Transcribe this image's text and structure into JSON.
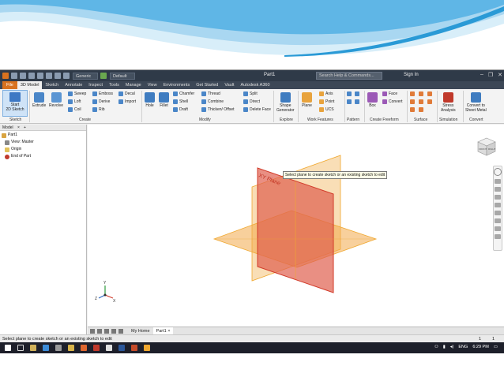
{
  "window": {
    "title": "Part1",
    "help_search_placeholder": "Search Help & Commands...",
    "sign_in": "Sign In",
    "material_combo": "Generic",
    "appearance_combo": "Default"
  },
  "tabs": [
    {
      "label": "File"
    },
    {
      "label": "3D Model"
    },
    {
      "label": "Sketch"
    },
    {
      "label": "Annotate"
    },
    {
      "label": "Inspect"
    },
    {
      "label": "Tools"
    },
    {
      "label": "Manage"
    },
    {
      "label": "View"
    },
    {
      "label": "Environments"
    },
    {
      "label": "Get Started"
    },
    {
      "label": "Vault"
    },
    {
      "label": "Autodesk A360"
    }
  ],
  "ribbon": {
    "start_sketch": "Start\n2D Sketch",
    "start_sketch_l1": "Start",
    "start_sketch_l2": "2D Sketch",
    "extrude": "Extrude",
    "revolve": "Revolve",
    "sweep": "Sweep",
    "loft": "Loft",
    "coil": "Coil",
    "emboss": "Emboss",
    "derive": "Derive",
    "rib": "Rib",
    "decal": "Decal",
    "import": "Import",
    "hole": "Hole",
    "fillet": "Fillet",
    "chamfer": "Chamfer",
    "shell": "Shell",
    "draft": "Draft",
    "thread": "Thread",
    "combine": "Combine",
    "thicken": "Thicken/ Offset",
    "split": "Split",
    "direct": "Direct",
    "delete_face": "Delete Face",
    "shape_generator_l1": "Shape",
    "shape_generator_l2": "Generator",
    "plane": "Plane",
    "axis": "Axis",
    "point": "Point",
    "ucs": "UCS",
    "box": "Box",
    "face": "Face",
    "convert": "Convert",
    "stress_l1": "Stress",
    "stress_l2": "Analysis",
    "sheetmetal_l1": "Convert to",
    "sheetmetal_l2": "Sheet Metal",
    "panels": {
      "sketch": "Sketch",
      "create": "Create",
      "modify": "Modify",
      "explore": "Explore",
      "work_features": "Work Features",
      "pattern": "Pattern",
      "create_freeform": "Create Freeform",
      "surface": "Surface",
      "simulation": "Simulation",
      "convert": "Convert"
    }
  },
  "browser": {
    "header": "Model",
    "tree": [
      {
        "label": "Part1",
        "indent": 0
      },
      {
        "label": "View: Master",
        "indent": 1
      },
      {
        "label": "Origin",
        "indent": 1
      },
      {
        "label": "End of Part",
        "indent": 1
      }
    ]
  },
  "viewport": {
    "plane_label": "XY Plane",
    "tooltip": "Select plane to create sketch or an existing sketch to edit",
    "viewcube_labels": {
      "front": "FRONT",
      "right": "RIGHT"
    },
    "axis_labels": {
      "x": "X",
      "y": "Y",
      "z": "Z"
    }
  },
  "doc_tabs": [
    {
      "label": "My Home"
    },
    {
      "label": "Part1"
    }
  ],
  "status": {
    "message": "Select plane to create sketch or an existing sketch to edit",
    "count1": "1",
    "count2": "1"
  },
  "taskbar": {
    "language": "ENG",
    "time": "6:29 PM"
  },
  "colors": {
    "accent_orange": "#d8721f",
    "plane_xy": "#e0604f",
    "plane_other": "#f2a94a",
    "title_bar": "#2f3a48",
    "swoosh_blue": "#2a9ad6"
  }
}
